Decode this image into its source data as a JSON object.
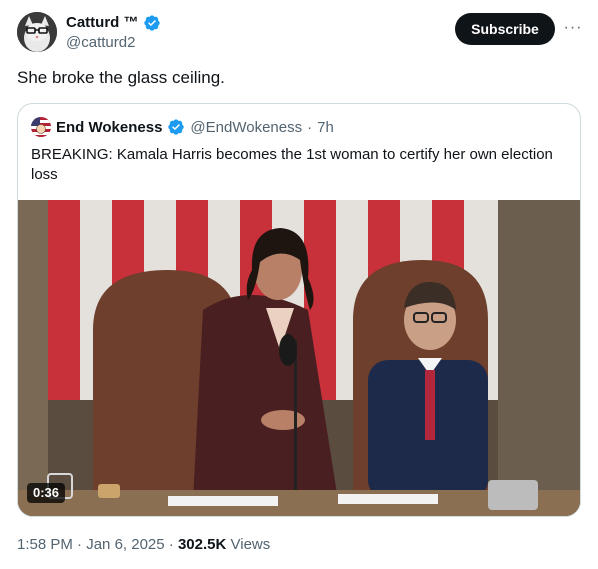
{
  "author": {
    "name": "Catturd ™",
    "handle": "@catturd2"
  },
  "header": {
    "subscribe_label": "Subscribe",
    "more_label": "···"
  },
  "tweet": {
    "text": "She broke the glass ceiling."
  },
  "quote": {
    "name": "End Wokeness",
    "handle": "@EndWokeness",
    "separator": "·",
    "time": "7h",
    "text": "BREAKING: Kamala Harris becomes the 1st woman to certify her own election loss",
    "video_duration": "0:36"
  },
  "meta": {
    "time": "1:58 PM",
    "dot1": "·",
    "date": "Jan 6, 2025",
    "dot2": "·",
    "views_count": "302.5K",
    "views_label": "Views"
  },
  "colors": {
    "verified": "#1d9bf0",
    "text_primary": "#0f1419",
    "text_secondary": "#536471",
    "border": "#cfd9de"
  },
  "icons": {
    "verified": "verified-badge-icon",
    "more": "more-dots-icon",
    "video": "video-thumbnail"
  }
}
